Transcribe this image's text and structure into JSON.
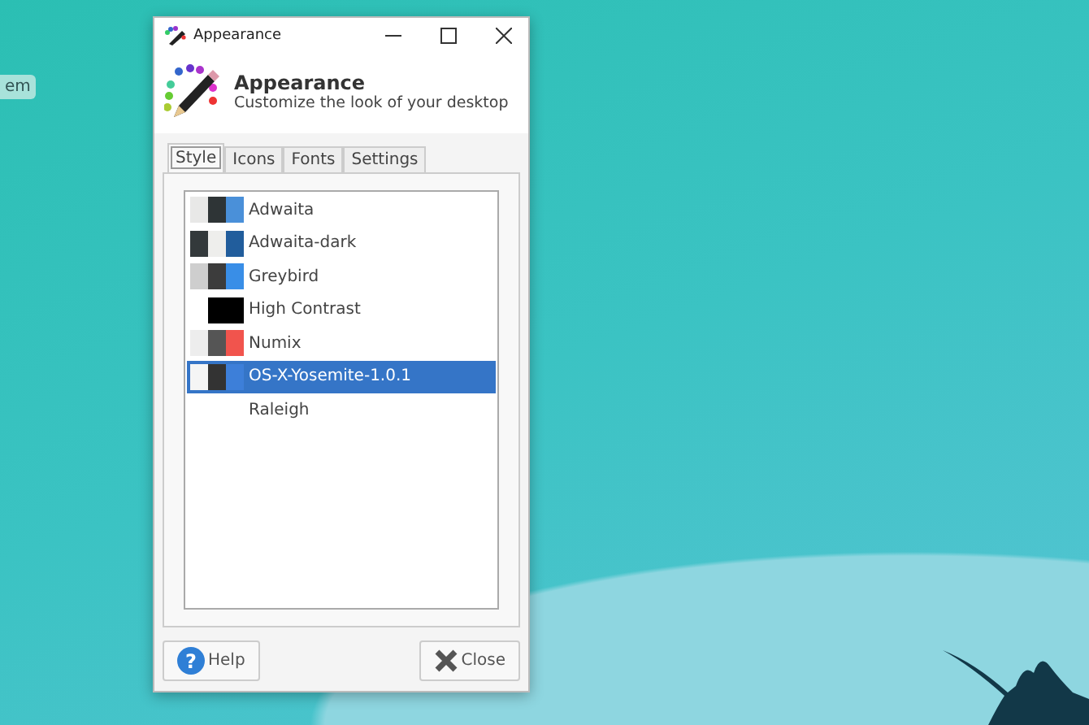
{
  "desktop": {
    "label": "em"
  },
  "window": {
    "title": "Appearance",
    "header": {
      "title": "Appearance",
      "subtitle": "Customize the look of your desktop"
    }
  },
  "tabs": [
    {
      "label": "Style",
      "selected": true
    },
    {
      "label": "Icons",
      "selected": false
    },
    {
      "label": "Fonts",
      "selected": false
    },
    {
      "label": "Settings",
      "selected": false
    }
  ],
  "themes": [
    {
      "name": "Adwaita",
      "selected": false,
      "swatches": [
        {
          "color": "#e8e8e7"
        },
        {
          "color": "#2e3436"
        },
        {
          "color": "#4a90d9"
        }
      ]
    },
    {
      "name": "Adwaita-dark",
      "selected": false,
      "swatches": [
        {
          "color": "#33393b"
        },
        {
          "color": "#eeeeec"
        },
        {
          "color": "#215d9c"
        }
      ]
    },
    {
      "name": "Greybird",
      "selected": false,
      "swatches": [
        {
          "color": "#cecece"
        },
        {
          "color": "#3c3c3c"
        },
        {
          "color": "#398ee7"
        }
      ]
    },
    {
      "name": "High Contrast",
      "selected": false,
      "swatches": [
        {
          "color": "#000000"
        },
        {
          "color": "#000000"
        }
      ]
    },
    {
      "name": "Numix",
      "selected": false,
      "swatches": [
        {
          "color": "#ededed"
        },
        {
          "color": "#555555"
        },
        {
          "color": "#f1544d"
        }
      ]
    },
    {
      "name": "OS-X-Yosemite-1.0.1",
      "selected": true,
      "swatches": [
        {
          "color": "#f5f5f5"
        },
        {
          "color": "#333333"
        },
        {
          "color": "#3d7fd9"
        }
      ]
    },
    {
      "name": "Raleigh",
      "selected": false
    }
  ],
  "buttons": [
    {
      "kind": "help",
      "label": "Help",
      "icon_glyph": "?"
    },
    {
      "kind": "close",
      "label": "Close"
    }
  ]
}
